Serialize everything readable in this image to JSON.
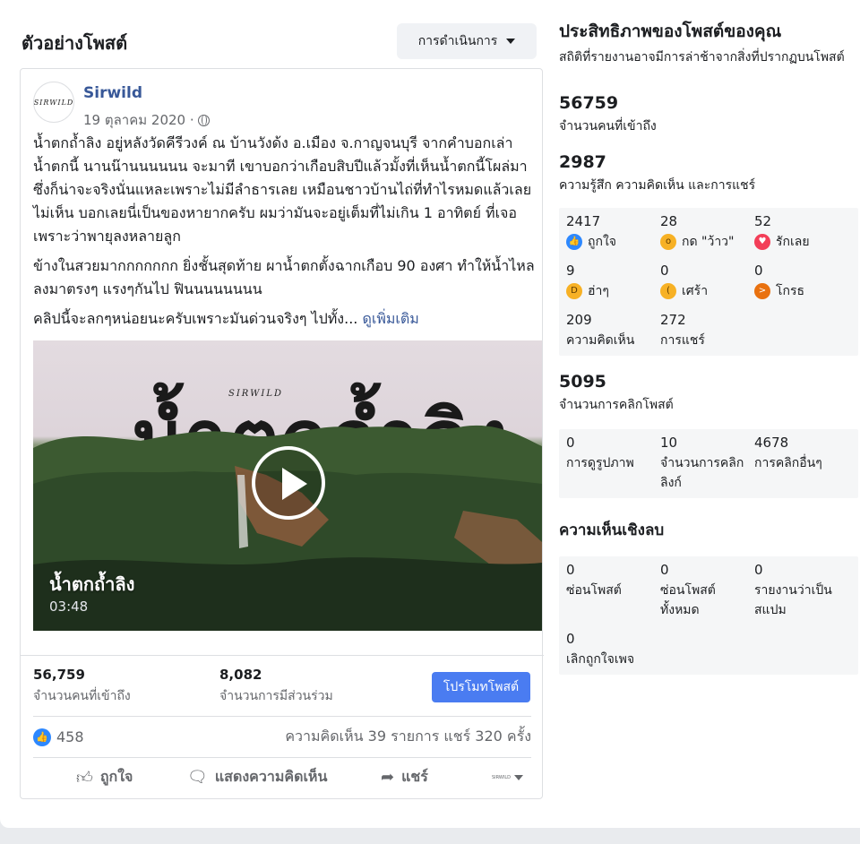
{
  "header": {
    "title": "ตัวอย่างโพสต์",
    "actions_label": "การดำเนินการ"
  },
  "post": {
    "avatar_text": "SIRWILD",
    "page_name": "Sirwild",
    "date": "19 ตุลาคม 2020 ·",
    "paragraphs": [
      "น้ำตกถ้ำลิง อยู่หลังวัดคีรีวงค์ ณ บ้านวังด้ง อ.เมือง จ.กาญจนบุรี จากคำบอกเล่าน้ำตกนี้ นานน๊านนนนนน จะมาที เขาบอกว่าเกือบสิบปีแล้วมั้งที่เห็นน้ำตกนี้โผล่มา ซึ่งก็น่าจะจริงนั่นแหละเพราะไม่มีลำธารเลย เหมือนชาวบ้านไถ่ที่ทำไรหมดแล้วเลยไม่เห็น บอกเลยนี่เป็นของหายากครับ ผมว่ามันจะอยู่เต็มที่ไม่เกิน 1 อาทิตย์ ที่เจอเพราะว่าพายุลงหลายลูก",
      "ข้างในสวยมากกกกกกก ยิ่งชั้นสุดท้าย ผาน้ำตกตั้งฉากเกือบ 90 องศา ทำให้น้ำไหลลงมาตรงๆ แรงๆกันไป ฟินนนนนนนน",
      "คลิปนี้จะลกๆหน่อยนะครับเพราะมันด่วนจริงๆ ไปทั้ง..."
    ],
    "see_more": "ดูเพิ่มเติม",
    "video": {
      "big_title": "น้ำตกถ้ำลิง",
      "brand": "SIRWILD",
      "title": "น้ำตกถ้ำลิง",
      "duration": "03:48"
    },
    "stats": {
      "reach_value": "56,759",
      "reach_label": "จำนวนคนที่เข้าถึง",
      "engagement_value": "8,082",
      "engagement_label": "จำนวนการมีส่วนร่วม"
    },
    "promote_label": "โปรโมทโพสต์",
    "like_count": "458",
    "comment_share": "ความคิดเห็น 39 รายการ  แชร์ 320 ครั้ง",
    "actions": {
      "like": "ถูกใจ",
      "comment": "แสดงความคิดเห็น",
      "share": "แชร์",
      "audience_tag": "SIRWILD"
    }
  },
  "insights": {
    "title": "ประสิทธิภาพของโพสต์ของคุณ",
    "subtitle": "สถิติที่รายงานอาจมีการล่าช้าจากสิ่งที่ปรากฏบนโพสต์",
    "reach": {
      "value": "56759",
      "label": "จำนวนคนที่เข้าถึง"
    },
    "engagement": {
      "value": "2987",
      "label": "ความรู้สึก ความคิดเห็น และการแชร์"
    },
    "reactions": [
      {
        "value": "2417",
        "label": "ถูกใจ",
        "icon": "like-reaction-icon",
        "color": "#2d88ff"
      },
      {
        "value": "28",
        "label": "กด \"ว้าว\"",
        "icon": "wow-reaction-icon",
        "color": "#f7b125"
      },
      {
        "value": "52",
        "label": "รักเลย",
        "icon": "love-reaction-icon",
        "color": "#f33e58"
      },
      {
        "value": "9",
        "label": "ฮ่าๆ",
        "icon": "haha-reaction-icon",
        "color": "#f7b125"
      },
      {
        "value": "0",
        "label": "เศร้า",
        "icon": "sad-reaction-icon",
        "color": "#f7b125"
      },
      {
        "value": "0",
        "label": "โกรธ",
        "icon": "angry-reaction-icon",
        "color": "#e9710f"
      },
      {
        "value": "209",
        "label": "ความคิดเห็น"
      },
      {
        "value": "272",
        "label": "การแชร์"
      }
    ],
    "clicks": {
      "value": "5095",
      "label": "จำนวนการคลิกโพสต์"
    },
    "click_breakdown": [
      {
        "value": "0",
        "label": "การดูรูปภาพ"
      },
      {
        "value": "10",
        "label": "จำนวนการคลิกลิงก์"
      },
      {
        "value": "4678",
        "label": "การคลิกอื่นๆ"
      }
    ],
    "negative_heading": "ความเห็นเชิงลบ",
    "negative": [
      {
        "value": "0",
        "label": "ซ่อนโพสต์"
      },
      {
        "value": "0",
        "label": "ซ่อนโพสต์ทั้งหมด"
      },
      {
        "value": "0",
        "label": "รายงานว่าเป็นสแปม"
      },
      {
        "value": "0",
        "label": "เลิกถูกใจเพจ"
      }
    ]
  }
}
